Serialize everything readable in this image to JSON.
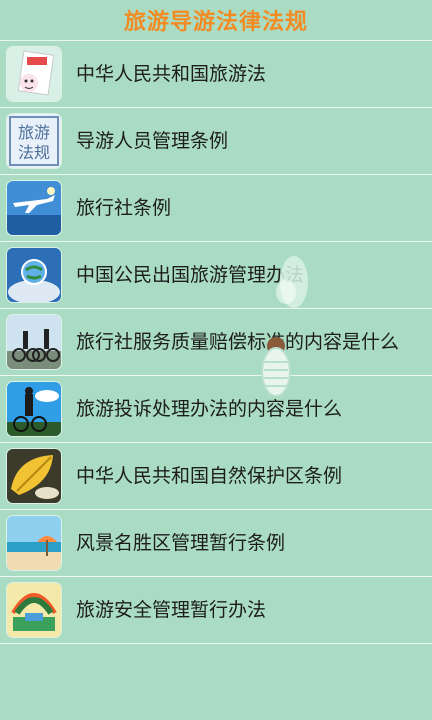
{
  "header": {
    "title": "旅游导游法律法规"
  },
  "items": [
    {
      "label": "中华人民共和国旅游法",
      "icon": "law-book-icon"
    },
    {
      "label": "导游人员管理条例",
      "icon": "travel-regulation-icon"
    },
    {
      "label": "旅行社条例",
      "icon": "airplane-icon"
    },
    {
      "label": "中国公民出国旅游管理办法",
      "icon": "globe-icon"
    },
    {
      "label": "旅行社服务质量赔偿标准的内容是什么",
      "icon": "cyclists-icon"
    },
    {
      "label": "旅游投诉处理办法的内容是什么",
      "icon": "cyclist-sky-icon"
    },
    {
      "label": "中华人民共和国自然保护区条例",
      "icon": "leaf-icon"
    },
    {
      "label": "风景名胜区管理暂行条例",
      "icon": "beach-icon"
    },
    {
      "label": "旅游安全管理暂行办法",
      "icon": "landscape-icon"
    }
  ],
  "thumb_text": {
    "item2_line1": "旅游",
    "item2_line2": "法规"
  },
  "colors": {
    "background": "#a9dcc2",
    "title": "#f38b25",
    "divider": "#eef8f2"
  }
}
